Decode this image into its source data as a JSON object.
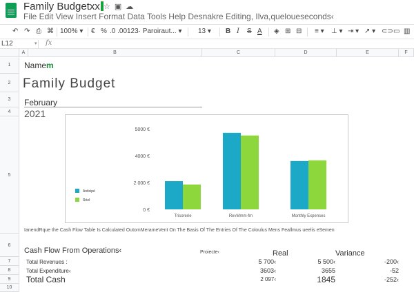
{
  "app": {
    "doc_title": "Family Budgetxx",
    "menu": "File Edit View Insert Format Data Tools Help Desnakre Editing, Ilva,queloueseconds‹"
  },
  "toolbar": {
    "zoom": "100%",
    "currency": "€",
    "percent": "%",
    "decimals": ".0 .00",
    "format": "123· Paroiraut...",
    "font_size": "13",
    "bold": "B",
    "italic": "I",
    "strike": "S",
    "text_color": "A"
  },
  "formula": {
    "cell_ref": "L12",
    "fx": "fx",
    "value": ""
  },
  "columns": [
    "A",
    "B",
    "C",
    "D",
    "E",
    "F"
  ],
  "rows": [
    "1",
    "2",
    "3",
    "4",
    "5",
    "6",
    "7",
    "8",
    "9",
    "10"
  ],
  "sheet": {
    "name_label": "Name",
    "name_cursor": "m",
    "title": "Family Budget",
    "month": "February",
    "year": "2021",
    "note": "IanendRque the Cash Flow Table Is Calculated OutomMerameVent On The Basis Of The Entries Of The Coloulus Mens Feallmus ueelis eSemen"
  },
  "cashflow": {
    "heading": "Cash Flow From Operations‹",
    "col_projected": "Proiecte‹",
    "col_real": "Real",
    "col_variance": "Variance",
    "rows": [
      {
        "label": "Total Revenues :",
        "projected": "5 700‹",
        "real": "5 500‹",
        "variance": "-200‹"
      },
      {
        "label": "Total Expenditure‹",
        "projected": "3603‹",
        "real": "3655",
        "variance": "-52"
      },
      {
        "label": "Total Cash",
        "projected": "2 097‹",
        "real": "1845",
        "variance": "-252‹"
      }
    ]
  },
  "colors": {
    "anticipated": "#1ba9c7",
    "real": "#8dd63b",
    "sheets_green": "#0f9d58"
  },
  "chart_data": {
    "type": "bar",
    "categories": [
      "Trisorerie",
      "RevMmm-fm",
      "Monthly Expenses"
    ],
    "series": [
      {
        "name": "Anticipé",
        "values": [
          2100,
          5700,
          3600
        ]
      },
      {
        "name": "Réel",
        "values": [
          1850,
          5500,
          3650
        ]
      }
    ],
    "y_ticks": [
      "0 €",
      "2 000 €",
      "4000 €",
      "5000 €"
    ],
    "y_tick_values": [
      0,
      2000,
      4000,
      6000
    ],
    "ylim": [
      0,
      6000
    ],
    "legend_position": "left",
    "grid": false
  }
}
